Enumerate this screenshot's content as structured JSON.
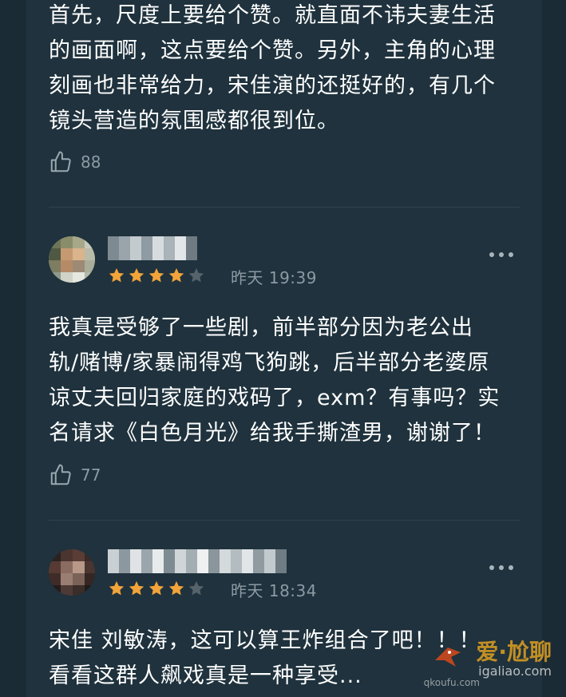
{
  "colors": {
    "background": "#1b2b35",
    "card": "#1f323d",
    "text": "#ffffff",
    "muted": "#8c9aa3",
    "star_filled": "#f2a33a",
    "star_empty": "#56636b"
  },
  "comments": [
    {
      "text": "首先，尺度上要给个赞。就直面不讳夫妻生活\n的画面啊，这点要给个赞。另外，主角的心理\n刻画也非常给力，宋佳演的还挺好的，有几个\n镜头营造的氛围感都很到位。",
      "likes": "88",
      "like_icon": "thumbs-up-icon"
    },
    {
      "rating": 4,
      "max_rating": 5,
      "time": "昨天 19:39",
      "text": "我真是受够了一些剧，前半部分因为老公出\n轨/赌博/家暴闹得鸡飞狗跳，后半部分老婆原\n谅丈夫回归家庭的戏码了，exm？有事吗？实\n名请求《白色月光》给我手撕渣男，谢谢了！",
      "likes": "77",
      "like_icon": "thumbs-up-icon"
    },
    {
      "rating": 4,
      "max_rating": 5,
      "time": "昨天 18:34",
      "text": "宋佳 刘敏涛，这可以算王炸组合了吧！！！\n看看这群人飙戏真是一种享受..."
    }
  ],
  "watermark": {
    "line1": "爱·尬聊",
    "line2": "igaliao.com",
    "line3": "qkoufu.com"
  }
}
